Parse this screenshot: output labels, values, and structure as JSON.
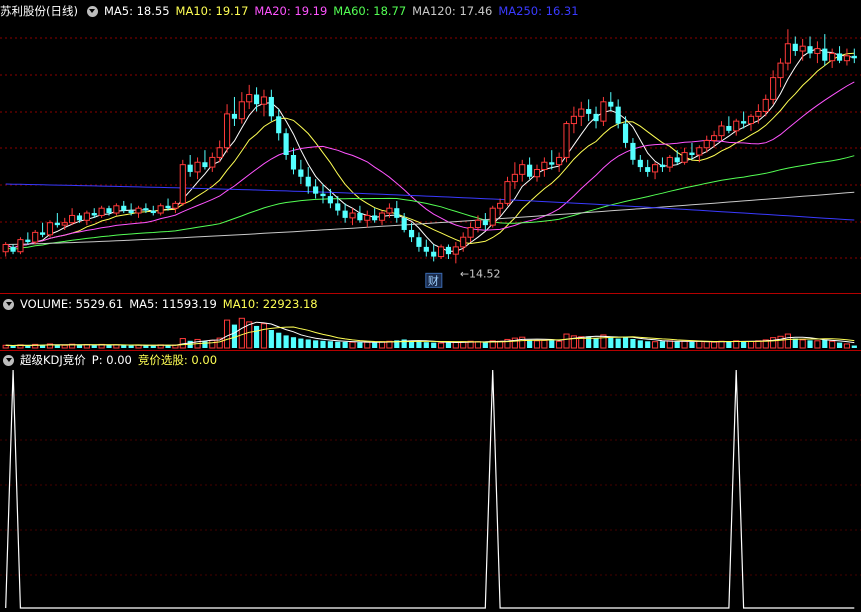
{
  "colors": {
    "up": "#ff3a3a",
    "down": "#54ffff",
    "ma5": "#ffffff",
    "ma10": "#ffff54",
    "ma20": "#ff54ff",
    "ma60": "#54ff54",
    "ma120": "#c8c8c8",
    "ma250": "#3a3aff",
    "grid": "#8c0000",
    "kdj": "#ffffff"
  },
  "main_header": {
    "title": "苏利股份(日线)",
    "ma5": "MA5: 18.55",
    "ma10": "MA10: 19.17",
    "ma20": "MA20: 19.19",
    "ma60": "MA60: 18.77",
    "ma120": "MA120: 17.46",
    "ma250": "MA250: 16.31"
  },
  "volume_header": {
    "label": "VOLUME: 5529.61",
    "ma5": "MA5: 11593.19",
    "ma10": "MA10: 22923.18"
  },
  "kdj_header": {
    "label": "超级KDJ竞价",
    "p": "P: 0.00",
    "sel": "竞价选股: 0.00"
  },
  "annotations": {
    "low_price": "←14.52",
    "cai_marker": "财"
  },
  "chart_data": [
    {
      "type": "candlestick",
      "title": "苏利股份(日线)",
      "ylim": [
        13.5,
        24.5
      ],
      "candles": [
        [
          15.0,
          15.4,
          14.8,
          15.3
        ],
        [
          15.2,
          15.3,
          14.9,
          15.0
        ],
        [
          15.0,
          15.6,
          14.9,
          15.5
        ],
        [
          15.5,
          15.8,
          15.3,
          15.4
        ],
        [
          15.4,
          15.9,
          15.3,
          15.8
        ],
        [
          15.8,
          16.2,
          15.6,
          15.7
        ],
        [
          15.7,
          16.3,
          15.6,
          16.2
        ],
        [
          16.2,
          16.6,
          16.0,
          16.1
        ],
        [
          16.1,
          16.4,
          15.9,
          16.2
        ],
        [
          16.2,
          16.8,
          16.1,
          16.5
        ],
        [
          16.5,
          16.6,
          16.2,
          16.3
        ],
        [
          16.3,
          16.7,
          16.1,
          16.6
        ],
        [
          16.6,
          16.8,
          16.4,
          16.5
        ],
        [
          16.5,
          16.9,
          16.4,
          16.8
        ],
        [
          16.8,
          16.9,
          16.5,
          16.6
        ],
        [
          16.6,
          17.0,
          16.5,
          16.9
        ],
        [
          16.9,
          17.1,
          16.6,
          16.7
        ],
        [
          16.7,
          17.0,
          16.5,
          16.6
        ],
        [
          16.6,
          16.9,
          16.4,
          16.8
        ],
        [
          16.8,
          17.0,
          16.6,
          16.7
        ],
        [
          16.7,
          16.9,
          16.5,
          16.6
        ],
        [
          16.6,
          17.0,
          16.5,
          16.9
        ],
        [
          16.9,
          17.2,
          16.7,
          16.8
        ],
        [
          16.8,
          17.1,
          16.6,
          17.0
        ],
        [
          17.0,
          18.8,
          16.9,
          18.6
        ],
        [
          18.6,
          19.0,
          18.1,
          18.3
        ],
        [
          18.3,
          18.9,
          18.0,
          18.7
        ],
        [
          18.7,
          19.2,
          18.4,
          18.5
        ],
        [
          18.5,
          19.1,
          18.3,
          18.9
        ],
        [
          18.9,
          19.6,
          18.7,
          19.3
        ],
        [
          19.3,
          21.1,
          19.1,
          20.7
        ],
        [
          20.7,
          21.4,
          20.2,
          20.5
        ],
        [
          20.5,
          21.6,
          20.3,
          21.2
        ],
        [
          21.2,
          21.9,
          20.9,
          21.5
        ],
        [
          21.5,
          21.8,
          20.8,
          21.1
        ],
        [
          21.1,
          21.7,
          20.6,
          21.4
        ],
        [
          21.4,
          21.7,
          20.4,
          20.6
        ],
        [
          20.6,
          20.9,
          19.6,
          19.9
        ],
        [
          19.9,
          20.1,
          18.8,
          19.0
        ],
        [
          19.0,
          19.3,
          18.2,
          18.4
        ],
        [
          18.4,
          18.8,
          17.8,
          18.1
        ],
        [
          18.1,
          18.5,
          17.4,
          17.7
        ],
        [
          17.7,
          18.0,
          17.2,
          17.4
        ],
        [
          17.4,
          17.8,
          17.0,
          17.3
        ],
        [
          17.3,
          17.6,
          16.8,
          17.0
        ],
        [
          17.0,
          17.3,
          16.5,
          16.7
        ],
        [
          16.7,
          17.0,
          16.2,
          16.4
        ],
        [
          16.4,
          16.8,
          16.1,
          16.6
        ],
        [
          16.6,
          16.9,
          16.2,
          16.3
        ],
        [
          16.3,
          16.7,
          16.0,
          16.5
        ],
        [
          16.5,
          16.8,
          16.2,
          16.3
        ],
        [
          16.3,
          16.7,
          16.1,
          16.6
        ],
        [
          16.6,
          17.0,
          16.4,
          16.8
        ],
        [
          16.8,
          17.1,
          16.2,
          16.4
        ],
        [
          16.4,
          16.6,
          15.8,
          15.9
        ],
        [
          15.9,
          16.2,
          15.4,
          15.6
        ],
        [
          15.6,
          15.8,
          15.0,
          15.2
        ],
        [
          15.2,
          15.5,
          14.8,
          15.0
        ],
        [
          15.0,
          15.3,
          14.6,
          14.8
        ],
        [
          14.8,
          15.3,
          14.7,
          15.2
        ],
        [
          15.2,
          15.3,
          14.7,
          14.9
        ],
        [
          14.9,
          15.4,
          14.52,
          15.2
        ],
        [
          15.2,
          15.8,
          15.0,
          15.6
        ],
        [
          15.6,
          16.2,
          15.4,
          16.0
        ],
        [
          16.0,
          16.5,
          15.8,
          16.3
        ],
        [
          16.3,
          16.6,
          15.9,
          16.1
        ],
        [
          16.1,
          16.9,
          16.0,
          16.8
        ],
        [
          16.8,
          17.2,
          16.5,
          17.0
        ],
        [
          17.0,
          18.1,
          16.9,
          17.9
        ],
        [
          17.9,
          18.7,
          17.6,
          18.2
        ],
        [
          18.2,
          18.8,
          17.9,
          18.6
        ],
        [
          18.6,
          18.9,
          18.0,
          18.1
        ],
        [
          18.1,
          18.6,
          17.9,
          18.4
        ],
        [
          18.4,
          18.9,
          18.1,
          18.7
        ],
        [
          18.7,
          19.2,
          18.4,
          18.6
        ],
        [
          18.6,
          19.1,
          18.3,
          18.9
        ],
        [
          18.9,
          20.4,
          18.7,
          20.3
        ],
        [
          20.3,
          21.0,
          19.9,
          20.6
        ],
        [
          20.6,
          21.2,
          20.2,
          20.9
        ],
        [
          20.9,
          21.3,
          20.4,
          20.7
        ],
        [
          20.7,
          21.0,
          20.1,
          20.4
        ],
        [
          20.4,
          21.4,
          20.2,
          21.2
        ],
        [
          21.2,
          21.6,
          20.8,
          21.0
        ],
        [
          21.0,
          21.3,
          20.1,
          20.3
        ],
        [
          20.3,
          20.6,
          19.3,
          19.5
        ],
        [
          19.5,
          19.7,
          18.6,
          18.8
        ],
        [
          18.8,
          19.0,
          18.3,
          18.5
        ],
        [
          18.5,
          18.8,
          18.1,
          18.3
        ],
        [
          18.3,
          18.7,
          18.0,
          18.6
        ],
        [
          18.6,
          18.9,
          18.3,
          18.5
        ],
        [
          18.5,
          19.0,
          18.3,
          18.9
        ],
        [
          18.9,
          19.2,
          18.6,
          18.7
        ],
        [
          18.7,
          19.3,
          18.6,
          19.1
        ],
        [
          19.1,
          19.5,
          18.8,
          19.0
        ],
        [
          19.0,
          19.4,
          18.7,
          19.3
        ],
        [
          19.3,
          19.8,
          19.1,
          19.6
        ],
        [
          19.6,
          20.0,
          19.3,
          19.8
        ],
        [
          19.8,
          20.4,
          19.6,
          20.2
        ],
        [
          20.2,
          20.6,
          19.9,
          20.0
        ],
        [
          20.0,
          20.5,
          19.8,
          20.4
        ],
        [
          20.4,
          20.8,
          20.1,
          20.3
        ],
        [
          20.3,
          20.7,
          20.0,
          20.6
        ],
        [
          20.6,
          21.1,
          20.3,
          20.8
        ],
        [
          20.8,
          21.5,
          20.6,
          21.3
        ],
        [
          21.3,
          22.5,
          21.1,
          22.2
        ],
        [
          22.2,
          23.0,
          21.8,
          22.8
        ],
        [
          22.8,
          24.2,
          22.5,
          23.6
        ],
        [
          23.6,
          23.9,
          23.1,
          23.3
        ],
        [
          23.3,
          23.8,
          22.9,
          23.5
        ],
        [
          23.5,
          23.9,
          23.0,
          23.2
        ],
        [
          23.2,
          23.7,
          22.8,
          23.4
        ],
        [
          23.4,
          24.0,
          22.7,
          22.9
        ],
        [
          22.9,
          23.4,
          22.6,
          23.2
        ],
        [
          23.2,
          23.5,
          22.8,
          22.9
        ],
        [
          22.9,
          23.4,
          22.7,
          23.1
        ],
        [
          23.1,
          23.4,
          22.8,
          23.0
        ]
      ],
      "moving_averages": [
        "MA5",
        "MA10",
        "MA20",
        "MA60",
        "MA120",
        "MA250"
      ],
      "ma250_range": [
        17.8,
        16.31
      ],
      "ma120_range": [
        15.3,
        17.46
      ],
      "ma60_base": 15.0,
      "low_label": 14.52
    },
    {
      "type": "bar",
      "title": "VOLUME",
      "ylim": [
        0,
        80000
      ],
      "values": [
        6000,
        5000,
        7000,
        5500,
        8000,
        6500,
        9000,
        7000,
        6000,
        8500,
        6500,
        7500,
        6000,
        8000,
        6500,
        7000,
        6000,
        5500,
        6500,
        6000,
        5000,
        7000,
        6000,
        6500,
        21000,
        16000,
        19000,
        15000,
        17000,
        22000,
        62000,
        52000,
        66000,
        58000,
        49000,
        54000,
        40000,
        34000,
        28000,
        24000,
        21000,
        19000,
        17000,
        16000,
        15000,
        14000,
        13500,
        13000,
        12500,
        13000,
        12000,
        14000,
        15000,
        17000,
        19000,
        16000,
        15000,
        13000,
        12000,
        11000,
        12000,
        13000,
        14000,
        15000,
        14000,
        13000,
        16000,
        15000,
        19000,
        22000,
        24000,
        18000,
        16000,
        17000,
        19000,
        15000,
        31000,
        27000,
        25000,
        26000,
        22000,
        29000,
        24000,
        21000,
        25000,
        20000,
        17000,
        15000,
        14000,
        15000,
        16000,
        14000,
        15000,
        13500,
        15000,
        14000,
        13000,
        15000,
        14000,
        16000,
        15000,
        14500,
        16000,
        18000,
        23000,
        26000,
        31000,
        21000,
        18000,
        17000,
        16000,
        19000,
        15000,
        12000,
        9000,
        5529.61
      ],
      "ma5_last": 11593.19,
      "ma10_last": 22923.18
    },
    {
      "type": "line",
      "title": "超级KDJ竞价",
      "ylim": [
        0,
        100
      ],
      "spikes_at": [
        1,
        66,
        99
      ],
      "p_value": 0.0,
      "select_value": 0.0
    }
  ]
}
